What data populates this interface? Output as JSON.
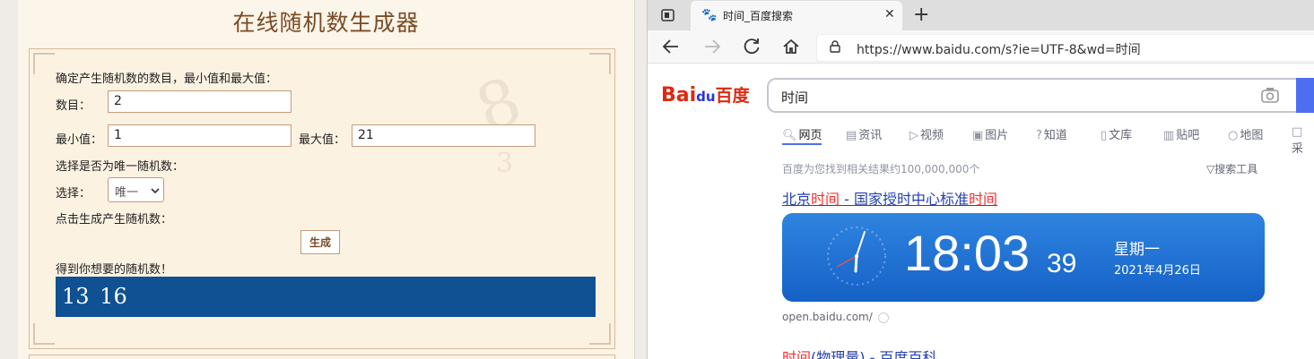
{
  "left": {
    "title": "在线随机数生成器",
    "intro": "确定产生随机数的数目，最小值和最大值：",
    "count_label": "数目：",
    "count_value": "2",
    "min_label": "最小值：",
    "min_value": "1",
    "max_label": "最大值：",
    "max_value": "21",
    "unique_prompt": "选择是否为唯一随机数：",
    "select_label": "选择：",
    "select_value": "唯一",
    "click_prompt": "点击生成产生随机数：",
    "generate_label": "生成",
    "result_prompt": "得到你想要的随机数！",
    "result_value": "13  16"
  },
  "browser": {
    "tab_title": "时间_百度搜索",
    "url": "https://www.baidu.com/s?ie=UTF-8&wd=时间",
    "icons": [
      "tab-actions-icon",
      "baidu-paw-icon",
      "close-icon",
      "plus-icon",
      "back-icon",
      "forward-icon",
      "refresh-icon",
      "home-icon",
      "lock-icon",
      "camera-icon",
      "search-icon"
    ]
  },
  "baidu": {
    "logo_left": "Bai",
    "logo_mid": "du",
    "logo_right": "百度",
    "query": "时间",
    "tabs": [
      "网页",
      "资讯",
      "视频",
      "图片",
      "知道",
      "文库",
      "贴吧",
      "地图",
      "采"
    ],
    "result_count": "百度为您找到相关结果约100,000,000个",
    "search_tools": "搜索工具",
    "r1_a": "北京",
    "r1_b": "时间",
    "r1_c": " - 国家授时中心标准",
    "r1_d": "时间",
    "time": "18:03",
    "seconds": "39",
    "weekday": "星期一",
    "date": "2021年4月26日",
    "source": "open.baidu.com/",
    "r2_a": "时间",
    "r2_b": "(物理量) - 百度百科",
    "accent": "#4e6ef2",
    "clock_bg": "#1561c7"
  }
}
